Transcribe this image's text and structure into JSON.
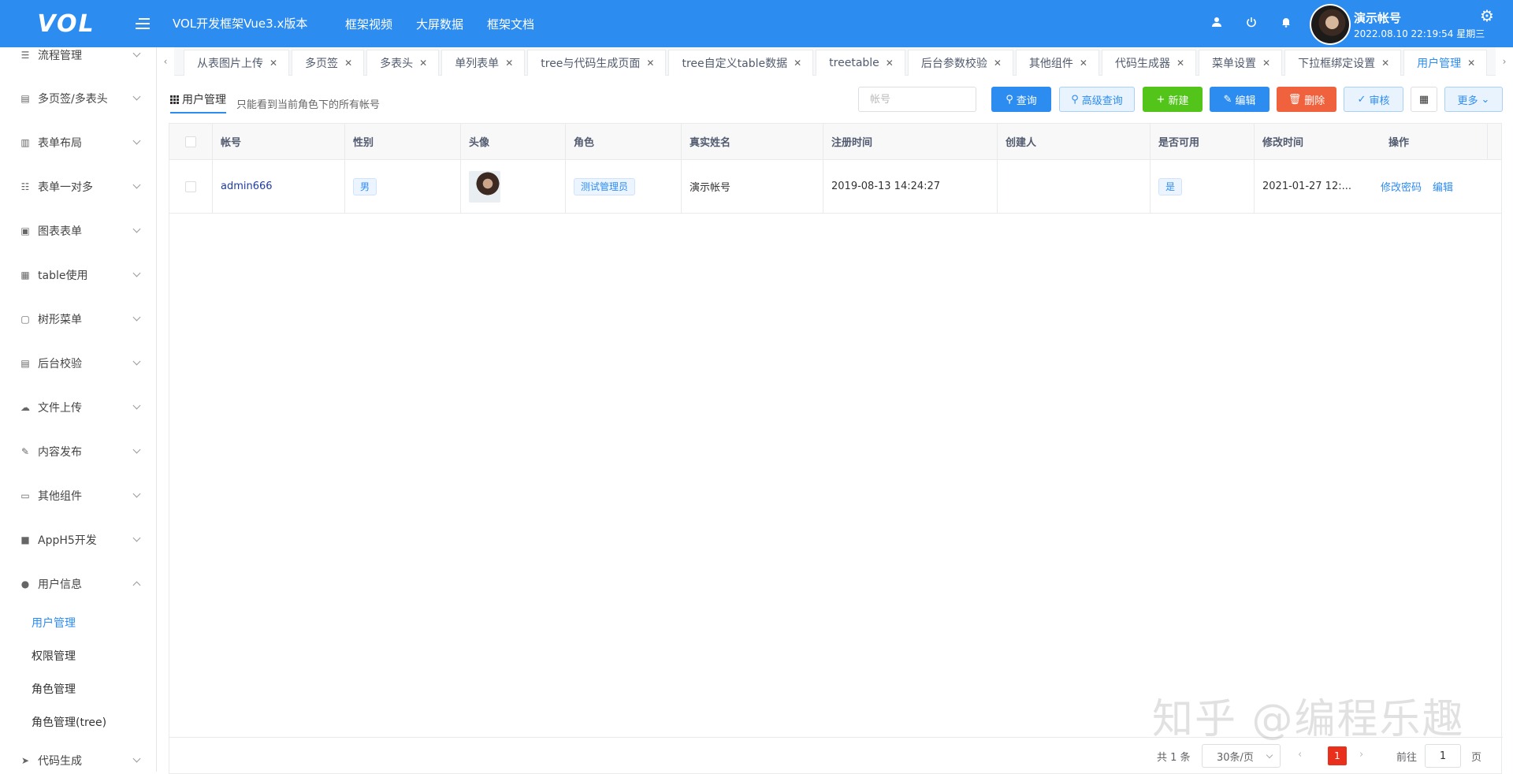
{
  "header": {
    "logo": "VOL",
    "title": "VOL开发框架Vue3.x版本",
    "nav": [
      "框架视频",
      "大屏数据",
      "框架文档"
    ],
    "user_name": "演示帐号",
    "datetime": "2022.08.10 22:19:54 星期三",
    "accent": "#2d8cf0"
  },
  "sidebar": {
    "items": [
      {
        "label": "流程管理",
        "icon": "flow-icon"
      },
      {
        "label": "多页签/多表头",
        "icon": "doc-icon"
      },
      {
        "label": "表单布局",
        "icon": "form-icon"
      },
      {
        "label": "表单一对多",
        "icon": "sliders-icon"
      },
      {
        "label": "图表表单",
        "icon": "chart-icon"
      },
      {
        "label": "table使用",
        "icon": "calendar-icon"
      },
      {
        "label": "树形菜单",
        "icon": "tree-icon"
      },
      {
        "label": "后台校验",
        "icon": "doc-icon"
      },
      {
        "label": "文件上传",
        "icon": "cloud-upload-icon"
      },
      {
        "label": "内容发布",
        "icon": "edit-icon"
      },
      {
        "label": "其他组件",
        "icon": "folder-icon"
      },
      {
        "label": "AppH5开发",
        "icon": "apps-icon"
      },
      {
        "label": "用户信息",
        "icon": "user-icon"
      },
      {
        "label": "代码生成",
        "icon": "send-icon"
      }
    ],
    "sub_items": [
      "用户管理",
      "权限管理",
      "角色管理",
      "角色管理(tree)"
    ]
  },
  "tabs": [
    "从表图片上传",
    "多页签",
    "多表头",
    "单列表单",
    "tree与代码生成页面",
    "tree自定义table数据",
    "treetable",
    "后台参数校验",
    "其他组件",
    "代码生成器",
    "菜单设置",
    "下拉框绑定设置",
    "用户管理"
  ],
  "page": {
    "title": "用户管理",
    "description": "只能看到当前角色下的所有帐号",
    "search_placeholder": "帐号"
  },
  "toolbar": {
    "query": "查询",
    "advanced_query": "高级查询",
    "new": "新建",
    "edit": "编辑",
    "delete": "删除",
    "audit": "审核",
    "more": "更多"
  },
  "table": {
    "columns": [
      "帐号",
      "性别",
      "头像",
      "角色",
      "真实姓名",
      "注册时间",
      "创建人",
      "是否可用",
      "修改时间",
      "操作"
    ],
    "rows": [
      {
        "account": "admin666",
        "gender": "男",
        "role": "测试管理员",
        "real_name": "演示帐号",
        "register_time": "2019-08-13 14:24:27",
        "creator": "",
        "enabled": "是",
        "modified_time": "2021-01-27 12:...",
        "actions": [
          "修改密码",
          "编辑"
        ]
      }
    ]
  },
  "pager": {
    "total": "共 1 条",
    "page_size": "30条/页",
    "current_page": "1",
    "goto_label": "前往",
    "goto_value": "1",
    "page_label": "页"
  },
  "watermark": "知乎 @编程乐趣"
}
